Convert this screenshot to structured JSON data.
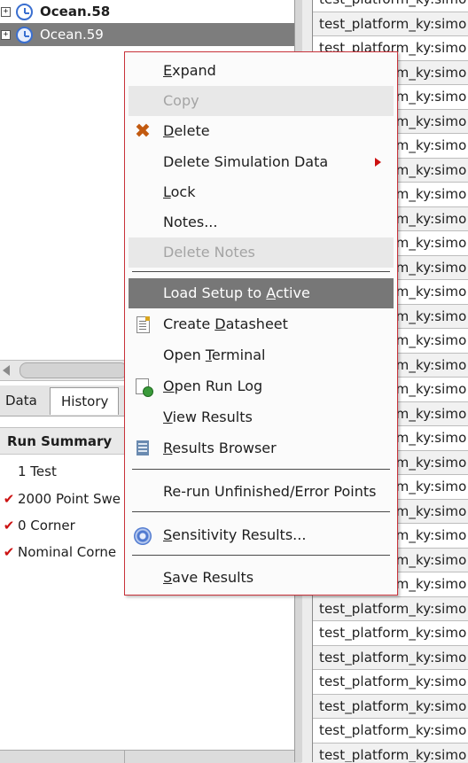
{
  "tree": {
    "items": [
      {
        "expander": "+",
        "label": "Ocean.58",
        "selected": false
      },
      {
        "expander": "+",
        "label": "Ocean.59",
        "selected": true
      }
    ]
  },
  "tabs": [
    {
      "label": "Data"
    },
    {
      "label": "History"
    }
  ],
  "summary": {
    "header": "Run Summary",
    "rows": [
      {
        "check": "",
        "label": "1 Test"
      },
      {
        "check": "✔",
        "label": "2000 Point Swe"
      },
      {
        "check": "✔",
        "label": "0 Corner"
      },
      {
        "check": "✔",
        "label": "Nominal Corne"
      }
    ]
  },
  "right_list": {
    "item_text": "test_platform_ky:simo",
    "row_count": 32
  },
  "context_menu": {
    "items": [
      {
        "label": "Expand",
        "mnemonic": "E",
        "state": "enabled",
        "icon": ""
      },
      {
        "label": "Copy",
        "mnemonic": "",
        "state": "disabled",
        "icon": ""
      },
      {
        "label": "Delete",
        "mnemonic": "D",
        "state": "enabled",
        "icon": "delete-x-icon"
      },
      {
        "label": "Delete Simulation Data",
        "mnemonic": "",
        "state": "enabled",
        "icon": "",
        "submenu": true
      },
      {
        "label": "Lock",
        "mnemonic": "L",
        "state": "enabled",
        "icon": ""
      },
      {
        "label": "Notes...",
        "mnemonic": "",
        "state": "enabled",
        "icon": ""
      },
      {
        "label": "Delete Notes",
        "mnemonic": "",
        "state": "disabled",
        "icon": ""
      },
      {
        "label": "Load Setup to Active",
        "mnemonic": "A",
        "state": "highlighted",
        "icon": ""
      },
      {
        "label": "Create Datasheet",
        "mnemonic": "D",
        "state": "enabled",
        "icon": "datasheet-icon"
      },
      {
        "label": "Open Terminal",
        "mnemonic": "T",
        "state": "enabled",
        "icon": ""
      },
      {
        "label": "Open Run Log",
        "mnemonic": "O",
        "state": "enabled",
        "icon": "run-log-icon"
      },
      {
        "label": "View Results",
        "mnemonic": "V",
        "state": "enabled",
        "icon": ""
      },
      {
        "label": "Results Browser",
        "mnemonic": "R",
        "state": "enabled",
        "icon": "results-browser-icon"
      },
      {
        "label": "Re-run Unfinished/Error Points",
        "mnemonic": "",
        "state": "enabled",
        "icon": ""
      },
      {
        "label": "Sensitivity Results...",
        "mnemonic": "S",
        "state": "enabled",
        "icon": "sensitivity-icon"
      },
      {
        "label": "Save Results",
        "mnemonic": "S",
        "state": "enabled",
        "icon": ""
      }
    ]
  },
  "colors": {
    "menu_border": "#c8323a",
    "highlight": "#777777",
    "selected_row": "#7d7d7d",
    "check": "#cc1111",
    "clock": "#3a6fd0"
  }
}
